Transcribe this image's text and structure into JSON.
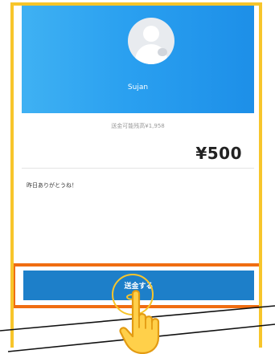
{
  "profile": {
    "user_name": "Sujan",
    "avatar_icon": "user-avatar-icon"
  },
  "transfer": {
    "balance_text": "送金可能残高¥1,958",
    "amount": "¥500",
    "message": "昨日ありがとうね！"
  },
  "actions": {
    "send_label": "送金する"
  },
  "colors": {
    "header_gradient_start": "#3fb1f3",
    "header_gradient_end": "#1d8fe8",
    "send_button": "#1d7fc9",
    "highlight_orange": "#f06d11",
    "frame_yellow": "#f7c52b"
  }
}
